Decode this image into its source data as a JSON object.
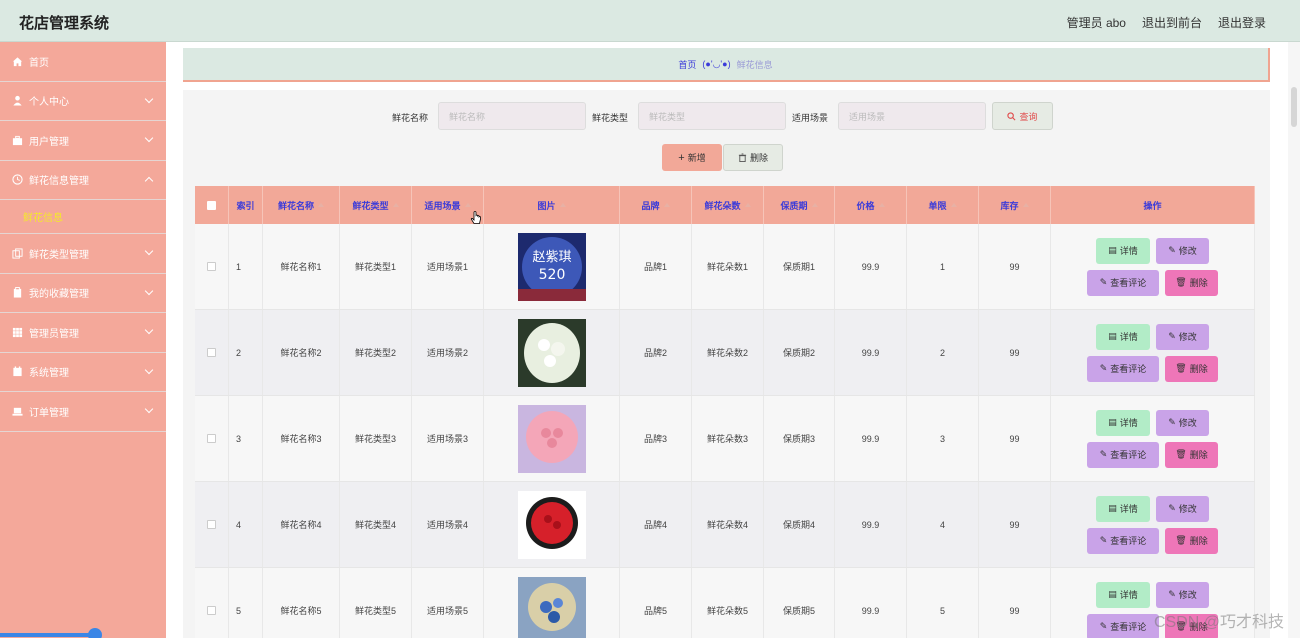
{
  "app": {
    "title": "花店管理系统"
  },
  "topbar": {
    "admin": "管理员 abo",
    "back": "退出到前台",
    "logout": "退出登录"
  },
  "sidebar": {
    "items": [
      {
        "label": "首页",
        "icon": "home-icon",
        "chevron": false
      },
      {
        "label": "个人中心",
        "icon": "user-icon",
        "chevron": true
      },
      {
        "label": "用户管理",
        "icon": "briefcase-icon",
        "chevron": true
      },
      {
        "label": "鲜花信息管理",
        "icon": "clock-icon",
        "chevron": true,
        "open": true,
        "sub": "鲜花信息"
      },
      {
        "label": "鲜花类型管理",
        "icon": "copy-icon",
        "chevron": true
      },
      {
        "label": "我的收藏管理",
        "icon": "clipboard-icon",
        "chevron": true
      },
      {
        "label": "管理员管理",
        "icon": "grid-icon",
        "chevron": true
      },
      {
        "label": "系统管理",
        "icon": "calendar-icon",
        "chevron": true
      },
      {
        "label": "订单管理",
        "icon": "laptop-icon",
        "chevron": true
      }
    ]
  },
  "breadcrumb": {
    "home": "首页",
    "face": "(●'◡'●)",
    "current": "鲜花信息"
  },
  "search": {
    "name_label": "鲜花名称",
    "name_placeholder": "鲜花名称",
    "type_label": "鲜花类型",
    "type_placeholder": "鲜花类型",
    "scene_label": "适用场景",
    "scene_placeholder": "适用场景",
    "query": "查询"
  },
  "actions": {
    "add": "新增",
    "delete": "删除"
  },
  "table": {
    "headers": [
      "索引",
      "鲜花名称",
      "鲜花类型",
      "适用场景",
      "图片",
      "品牌",
      "鲜花朵数",
      "保质期",
      "价格",
      "单限",
      "库存",
      "操作"
    ],
    "rows": [
      {
        "index": "1",
        "name": "鲜花名称1",
        "type": "鲜花类型1",
        "scene": "适用场景1",
        "brand": "品牌1",
        "count": "鲜花朵数1",
        "shelf": "保质期1",
        "price": "99.9",
        "limit": "1",
        "stock": "99",
        "img_text": "赵紫琪 520"
      },
      {
        "index": "2",
        "name": "鲜花名称2",
        "type": "鲜花类型2",
        "scene": "适用场景2",
        "brand": "品牌2",
        "count": "鲜花朵数2",
        "shelf": "保质期2",
        "price": "99.9",
        "limit": "2",
        "stock": "99"
      },
      {
        "index": "3",
        "name": "鲜花名称3",
        "type": "鲜花类型3",
        "scene": "适用场景3",
        "brand": "品牌3",
        "count": "鲜花朵数3",
        "shelf": "保质期3",
        "price": "99.9",
        "limit": "3",
        "stock": "99"
      },
      {
        "index": "4",
        "name": "鲜花名称4",
        "type": "鲜花类型4",
        "scene": "适用场景4",
        "brand": "品牌4",
        "count": "鲜花朵数4",
        "shelf": "保质期4",
        "price": "99.9",
        "limit": "4",
        "stock": "99"
      },
      {
        "index": "5",
        "name": "鲜花名称5",
        "type": "鲜花类型5",
        "scene": "适用场景5",
        "brand": "品牌5",
        "count": "鲜花朵数5",
        "shelf": "保质期5",
        "price": "99.9",
        "limit": "5",
        "stock": "99"
      }
    ],
    "ops": {
      "detail": "详情",
      "edit": "修改",
      "comment": "查看评论",
      "delete": "删除"
    }
  },
  "watermark": "CSDN @巧才科技"
}
